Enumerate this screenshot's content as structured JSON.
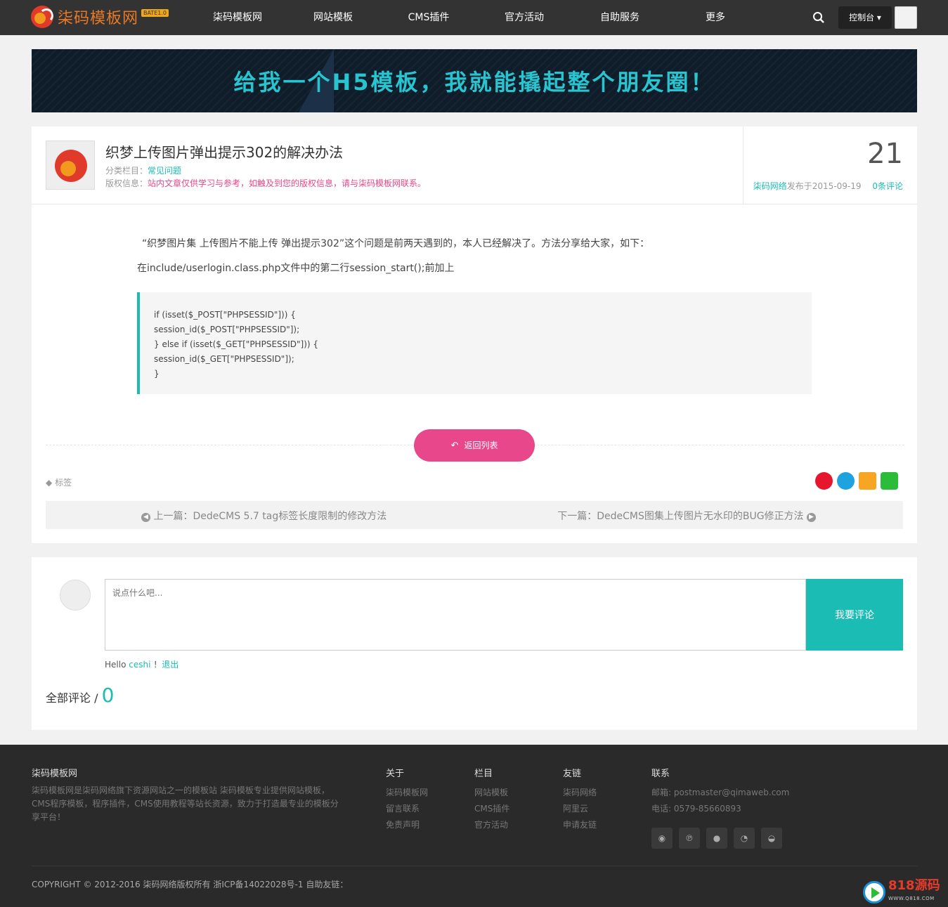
{
  "header": {
    "logo_text": "柒码模板网",
    "logo_badge": "BATE1.0",
    "nav": [
      "柒码模板网",
      "网站模板",
      "CMS插件",
      "官方活动",
      "自助服务",
      "更多"
    ],
    "control_label": "控制台 ▾"
  },
  "banner": {
    "text": "给我一个H5模板，我就能撬起整个朋友圈！"
  },
  "article": {
    "title": "织梦上传图片弹出提示302的解决办法",
    "category_label": "分类栏目：",
    "category_value": "常见问题",
    "copyright_label": "版权信息：",
    "copyright_value": "站内文章仅供学习与参考，如触及到您的版权信息，请与柒码模板网联系。",
    "day": "21",
    "author": "柒码网络",
    "published": "发布于2015-09-19",
    "comments_link": "0条评论",
    "paragraph1": "“织梦图片集 上传图片不能上传 弹出提示302”这个问题是前两天遇到的，本人已经解决了。方法分享给大家，如下：",
    "paragraph2": "在include/userlogin.class.php文件中的第二行session_start();前加上",
    "code_lines": [
      "if (isset($_POST[\"PHPSESSID\"])) {",
      "session_id($_POST[\"PHPSESSID\"]);",
      "} else if (isset($_GET[\"PHPSESSID\"])) {",
      "session_id($_GET[\"PHPSESSID\"]);",
      "}"
    ],
    "back_label": "返回列表",
    "tags_label": "标签",
    "prev": "上一篇：DedeCMS 5.7 tag标签长度限制的修改方法",
    "next": "下一篇：DedeCMS图集上传图片无水印的BUG修正方法"
  },
  "comment": {
    "placeholder": "说点什么吧...",
    "submit_label": "我要评论",
    "hello": "Hello",
    "username": "ceshi",
    "sep": "！",
    "logout": "退出",
    "total_label": "全部评论 / ",
    "total_count": "0"
  },
  "footer": {
    "site_title": "柒码模板网",
    "site_desc": "柒码模板网是柒码网络旗下资源网站之一的模板站 柒码模板专业提供网站模板，CMS程序模板，程序插件，CMS使用教程等站长资源，致力于打造最专业的模板分享平台！",
    "cols": [
      {
        "head": "关于",
        "links": [
          "柒码模板网",
          "留言联系",
          "免责声明"
        ]
      },
      {
        "head": "栏目",
        "links": [
          "网站模板",
          "CMS插件",
          "官方活动"
        ]
      },
      {
        "head": "友链",
        "links": [
          "柒码网络",
          "阿里云",
          "申请友链"
        ]
      }
    ],
    "contact_head": "联系",
    "email": "邮箱: postmaster@qimaweb.com",
    "phone": "电话: 0579-85660893",
    "copyright": "COPYRIGHT © 2012-2016 柒码网络版权所有 浙ICP备14022028号-1 自助友链：",
    "watermark": "818源码",
    "watermark_sub": "WWW.Q818.COM"
  },
  "colors": {
    "accent_teal": "#1bbcb3",
    "accent_pink": "#e8478b",
    "header_bg": "#333333",
    "footer_bg": "#2a2a2a"
  }
}
